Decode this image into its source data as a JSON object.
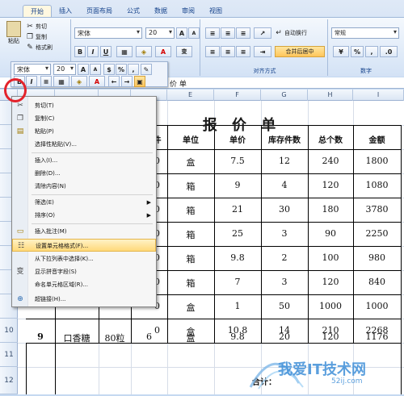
{
  "tabs": [
    "开始",
    "插入",
    "页面布局",
    "公式",
    "数据",
    "审阅",
    "视图"
  ],
  "clipboard": {
    "paste": "粘贴",
    "cut": "剪切",
    "copy": "复制",
    "format_painter": "格式刷"
  },
  "font": {
    "name": "宋体",
    "size": "20",
    "bold": "B",
    "italic": "I",
    "underline": "U",
    "grow": "A",
    "shrink": "A",
    "color_letter": "A",
    "phonetic": "变"
  },
  "alignment": {
    "wrap": "自动换行",
    "merge": "合并后居中",
    "label": "对齐方式"
  },
  "number": {
    "format": "常规",
    "label": "数字",
    "percent": "%",
    "comma": ","
  },
  "minibar": {
    "font": "宋体",
    "size": "20",
    "grow": "A",
    "shrink": "A",
    "currency": "$",
    "percent": "%",
    "comma": ",",
    "bold": "B",
    "italic": "I",
    "font_color": "A"
  },
  "formula_bar_text": "价 单",
  "columns": [
    "",
    "",
    "",
    "",
    "E",
    "F",
    "G",
    "H",
    "I"
  ],
  "rows": [
    "",
    "",
    "",
    "",
    "",
    "",
    "",
    "",
    "",
    "10",
    "11",
    "12"
  ],
  "title": "报 价 单",
  "headers": {
    "qty_suffix": "件",
    "unit": "单位",
    "price": "单价",
    "stock": "库存件数",
    "total_qty": "总个数",
    "amount": "金额"
  },
  "table_rows": [
    {
      "idx": "",
      "name": "",
      "spec": "",
      "count": "0",
      "unit": "盒",
      "price": "7.5",
      "stock": "12",
      "total": "240",
      "amount": "1800"
    },
    {
      "idx": "",
      "name": "",
      "spec": "",
      "count": "0",
      "unit": "箱",
      "price": "9",
      "stock": "4",
      "total": "120",
      "amount": "1080"
    },
    {
      "idx": "",
      "name": "",
      "spec": "",
      "count": "0",
      "unit": "箱",
      "price": "21",
      "stock": "30",
      "total": "180",
      "amount": "3780"
    },
    {
      "idx": "",
      "name": "",
      "spec": "",
      "count": "0",
      "unit": "箱",
      "price": "25",
      "stock": "3",
      "total": "90",
      "amount": "2250"
    },
    {
      "idx": "",
      "name": "",
      "spec": "",
      "count": "0",
      "unit": "箱",
      "price": "9.8",
      "stock": "2",
      "total": "100",
      "amount": "980"
    },
    {
      "idx": "",
      "name": "",
      "spec": "",
      "count": "0",
      "unit": "箱",
      "price": "7",
      "stock": "3",
      "total": "120",
      "amount": "840"
    },
    {
      "idx": "",
      "name": "",
      "spec": "",
      "count": "0",
      "unit": "盒",
      "price": "1",
      "stock": "50",
      "total": "1000",
      "amount": "1000"
    },
    {
      "idx": "",
      "name": "",
      "spec": "",
      "count": "0",
      "unit": "盒",
      "price": "10.8",
      "stock": "14",
      "total": "210",
      "amount": "2268"
    },
    {
      "idx": "9",
      "name": "口香糖",
      "spec": "80粒",
      "count": "6",
      "unit": "盒",
      "price": "9.8",
      "stock": "20",
      "total": "120",
      "amount": "1176"
    }
  ],
  "total_label": "合计：",
  "context_menu": [
    {
      "label": "剪切(T)",
      "icon": "scissors-icon",
      "glyph": "✂"
    },
    {
      "label": "复制(C)",
      "icon": "copy-icon",
      "glyph": "❐"
    },
    {
      "label": "粘贴(P)",
      "icon": "paste-icon",
      "glyph": "📋"
    },
    {
      "label": "选择性粘贴(V)...",
      "icon": "",
      "glyph": ""
    },
    {
      "label": "插入(I)...",
      "icon": "",
      "glyph": ""
    },
    {
      "label": "删除(D)...",
      "icon": "",
      "glyph": ""
    },
    {
      "label": "清除内容(N)",
      "icon": "",
      "glyph": ""
    },
    {
      "label": "筛选(E)",
      "icon": "",
      "glyph": "",
      "submenu": true
    },
    {
      "label": "排序(O)",
      "icon": "",
      "glyph": "",
      "submenu": true
    },
    {
      "label": "插入批注(M)",
      "icon": "comment-icon",
      "glyph": "▭"
    },
    {
      "label": "设置单元格格式(F)...",
      "icon": "format-cells-icon",
      "glyph": "☷",
      "highlight": true
    },
    {
      "label": "从下拉列表中选择(K)...",
      "icon": "",
      "glyph": ""
    },
    {
      "label": "显示拼音字段(S)",
      "icon": "phonetic-icon",
      "glyph": "变"
    },
    {
      "label": "命名单元格区域(R)...",
      "icon": "",
      "glyph": ""
    },
    {
      "label": "超链接(H)...",
      "icon": "hyperlink-icon",
      "glyph": "🔗"
    }
  ],
  "watermark": {
    "main": "我爱IT技术网",
    "sub": "52ij.com"
  },
  "colors": {
    "accent": "#15428b",
    "highlight": "#ffd97a",
    "circle": "#e3232b"
  }
}
